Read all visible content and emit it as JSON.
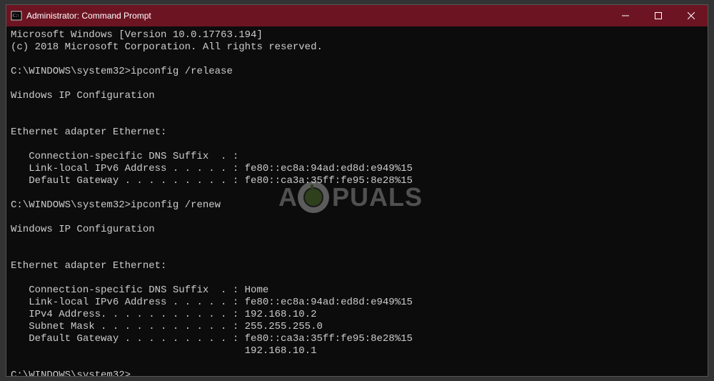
{
  "titlebar": {
    "title": "Administrator: Command Prompt"
  },
  "terminal": {
    "lines": [
      "Microsoft Windows [Version 10.0.17763.194]",
      "(c) 2018 Microsoft Corporation. All rights reserved.",
      "",
      "C:\\WINDOWS\\system32>ipconfig /release",
      "",
      "Windows IP Configuration",
      "",
      "",
      "Ethernet adapter Ethernet:",
      "",
      "   Connection-specific DNS Suffix  . :",
      "   Link-local IPv6 Address . . . . . : fe80::ec8a:94ad:ed8d:e949%15",
      "   Default Gateway . . . . . . . . . : fe80::ca3a:35ff:fe95:8e28%15",
      "",
      "C:\\WINDOWS\\system32>ipconfig /renew",
      "",
      "Windows IP Configuration",
      "",
      "",
      "Ethernet adapter Ethernet:",
      "",
      "   Connection-specific DNS Suffix  . : Home",
      "   Link-local IPv6 Address . . . . . : fe80::ec8a:94ad:ed8d:e949%15",
      "   IPv4 Address. . . . . . . . . . . : 192.168.10.2",
      "   Subnet Mask . . . . . . . . . . . : 255.255.255.0",
      "   Default Gateway . . . . . . . . . : fe80::ca3a:35ff:fe95:8e28%15",
      "                                       192.168.10.1",
      ""
    ],
    "prompt": "C:\\WINDOWS\\system32>"
  },
  "watermark": {
    "text_left": "A",
    "text_right": "PUALS"
  }
}
